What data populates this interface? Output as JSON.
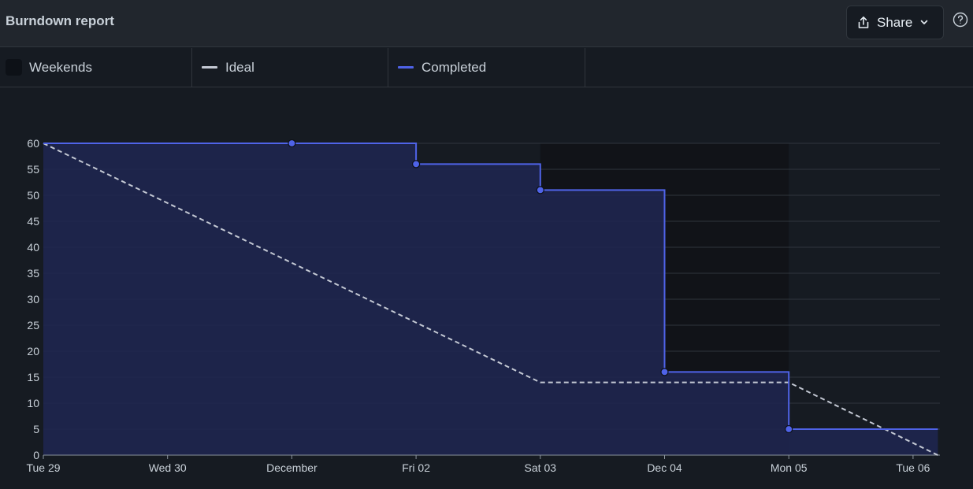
{
  "header": {
    "title": "Burndown report",
    "share_label": "Share"
  },
  "legend": {
    "weekends_label": "Weekends",
    "ideal_label": "Ideal",
    "completed_label": "Completed"
  },
  "colors": {
    "completed": "#4f63e8",
    "ideal": "#c4c9d4",
    "weekend_band": "#111318",
    "area_fill": "#1f2650",
    "grid": "#30363d"
  },
  "chart_data": {
    "type": "line",
    "x": [
      "Tue 29",
      "Wed 30",
      "December",
      "Fri 02",
      "Sat 03",
      "Dec 04",
      "Mon 05",
      "Tue 06"
    ],
    "yticks": [
      0,
      5,
      10,
      15,
      20,
      25,
      30,
      35,
      40,
      45,
      50,
      55,
      60
    ],
    "ylim": [
      0,
      60
    ],
    "weekends": [
      [
        4,
        6
      ]
    ],
    "series": [
      {
        "name": "Completed",
        "step": true,
        "points": [
          [
            0,
            60
          ],
          [
            2,
            60
          ],
          [
            3,
            56
          ],
          [
            4,
            51
          ],
          [
            5,
            16
          ],
          [
            6,
            5
          ],
          [
            7.2,
            5
          ]
        ],
        "markers": [
          [
            2,
            60
          ],
          [
            3,
            56
          ],
          [
            4,
            51
          ],
          [
            5,
            16
          ],
          [
            6,
            5
          ]
        ]
      },
      {
        "name": "Ideal",
        "dashed": true,
        "points": [
          [
            0,
            60
          ],
          [
            4,
            14
          ],
          [
            6,
            14
          ],
          [
            7.2,
            0
          ]
        ]
      }
    ]
  }
}
